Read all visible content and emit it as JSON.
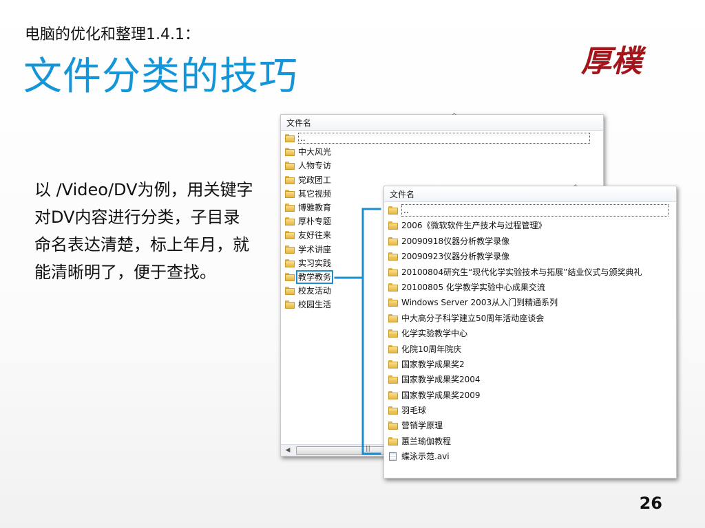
{
  "slide": {
    "subtitle": "电脑的优化和整理1.4.1：",
    "title": "文件分类的技巧",
    "logo_text": "厚樸",
    "body": "以 /Video/DV为例，用关键字对DV内容进行分类，子目录命名表达清楚，标上年月，就能清晰明了，便于查找。",
    "page_number": "26"
  },
  "window_left": {
    "column_header": "文件名",
    "items": [
      {
        "label": "..",
        "type": "parent"
      },
      {
        "label": "中大风光",
        "type": "folder"
      },
      {
        "label": "人物专访",
        "type": "folder"
      },
      {
        "label": "党政团工",
        "type": "folder"
      },
      {
        "label": "其它视频",
        "type": "folder"
      },
      {
        "label": "博雅教育",
        "type": "folder"
      },
      {
        "label": "厚朴专题",
        "type": "folder"
      },
      {
        "label": "友好往来",
        "type": "folder"
      },
      {
        "label": "学术讲座",
        "type": "folder"
      },
      {
        "label": "实习实践",
        "type": "folder"
      },
      {
        "label": "教学教务",
        "type": "folder",
        "highlighted": true
      },
      {
        "label": "校友活动",
        "type": "folder"
      },
      {
        "label": "校园生活",
        "type": "folder"
      }
    ]
  },
  "window_right": {
    "column_header": "文件名",
    "items": [
      {
        "label": "..",
        "type": "parent"
      },
      {
        "label": "2006《微软软件生产技术与过程管理》",
        "type": "folder"
      },
      {
        "label": "20090918仪器分析教学录像",
        "type": "folder"
      },
      {
        "label": "20090923仪器分析教学录像",
        "type": "folder"
      },
      {
        "label": "20100804研究生“现代化学实验技术与拓展”结业仪式与颁奖典礼",
        "type": "folder"
      },
      {
        "label": "20100805 化学教学实验中心成果交流",
        "type": "folder"
      },
      {
        "label": "Windows Server 2003从入门到精通系列",
        "type": "folder"
      },
      {
        "label": "中大高分子科学建立50周年活动座谈会",
        "type": "folder"
      },
      {
        "label": "化学实验教学中心",
        "type": "folder"
      },
      {
        "label": "化院10周年院庆",
        "type": "folder"
      },
      {
        "label": "国家教学成果奖2",
        "type": "folder"
      },
      {
        "label": "国家教学成果奖2004",
        "type": "folder"
      },
      {
        "label": "国家教学成果奖2009",
        "type": "folder"
      },
      {
        "label": "羽毛球",
        "type": "folder"
      },
      {
        "label": "营销学原理",
        "type": "folder"
      },
      {
        "label": "蕙兰瑜伽教程",
        "type": "folder"
      },
      {
        "label": "蝶泳示范.avi",
        "type": "file"
      }
    ]
  },
  "colors": {
    "title": "#1495d8",
    "highlight": "#1a8ed0",
    "logo": "#a3141b",
    "folder": "#e6b43f"
  }
}
